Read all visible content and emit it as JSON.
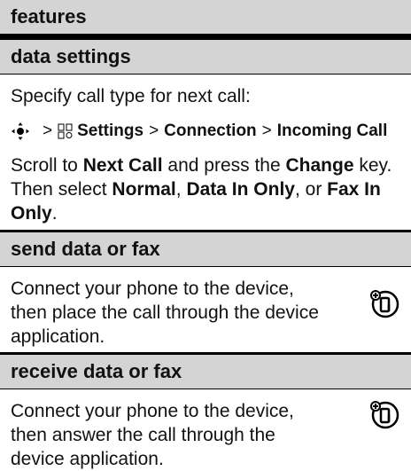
{
  "header": {
    "title": "features"
  },
  "sections": [
    {
      "title": "data settings",
      "intro": "Specify call type for next call:",
      "path": {
        "settings": "Settings",
        "connection": "Connection",
        "incoming": "Incoming Call",
        "separator": ">"
      },
      "line1_a": "Scroll to ",
      "line1_b": "Next Call",
      "line1_c": " and press the ",
      "line1_d": "Change",
      "line1_e": " key.",
      "line2_a": "Then select ",
      "line2_b": "Normal",
      "line2_c": ", ",
      "line2_d": "Data In Only",
      "line2_e": ", or ",
      "line2_f": "Fax In Only",
      "line2_g": "."
    },
    {
      "title": "send data or fax",
      "lines": [
        "Connect your phone to the device,",
        "then place the call through the device",
        "application."
      ]
    },
    {
      "title": "receive data or fax",
      "lines": [
        "Connect your phone to the device,",
        "then answer the call through the",
        "device application."
      ]
    }
  ],
  "icons": {
    "nav": "nav-key-icon",
    "settings": "settings-icon",
    "accessory": "accessory-phone-icon"
  }
}
